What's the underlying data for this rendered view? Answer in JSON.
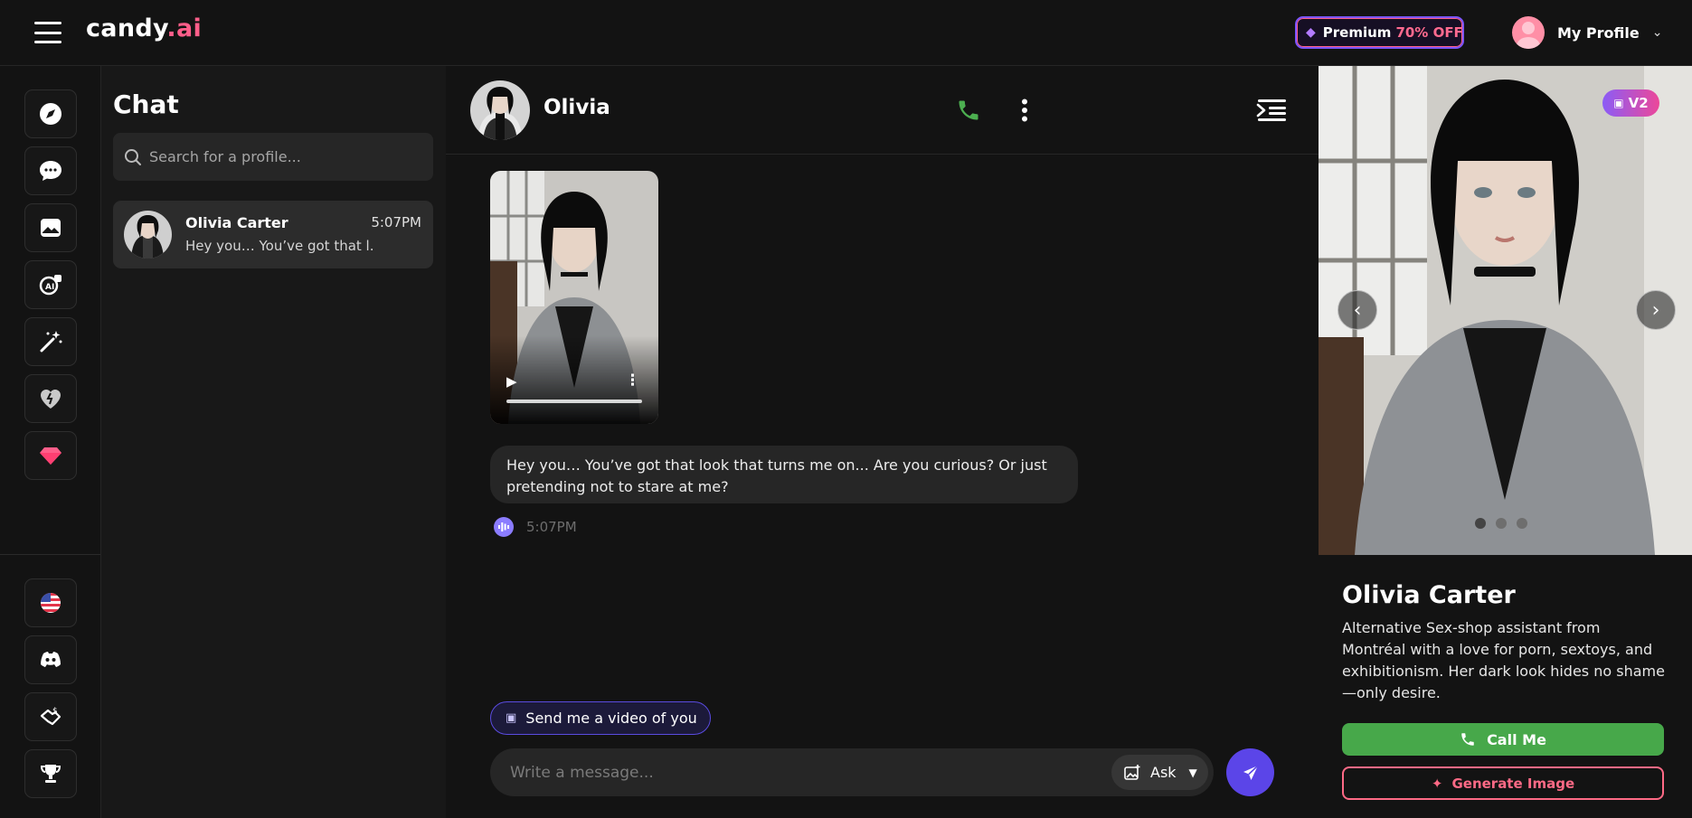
{
  "app": {
    "logo_main": "candy",
    "logo_accent": ".ai"
  },
  "header": {
    "premium_label": "Premium",
    "premium_discount": "70% OFF",
    "profile_label": "My Profile"
  },
  "sidebar": {
    "top_icons": [
      "compass-icon",
      "chat-bubble-icon",
      "image-gallery-icon",
      "ai-avatar-icon",
      "magic-wand-icon",
      "heart-icon",
      "diamond-icon"
    ],
    "bottom_icons": [
      "us-flag-icon",
      "discord-icon",
      "affiliate-icon",
      "trophy-icon"
    ]
  },
  "chat_list": {
    "title": "Chat",
    "search_placeholder": "Search for a profile...",
    "conversations": [
      {
        "name": "Olivia Carter",
        "time": "5:07PM",
        "preview": "Hey you… You’ve got that l..."
      }
    ]
  },
  "conversation": {
    "title": "Olivia",
    "messages": [
      {
        "type": "video"
      },
      {
        "type": "text",
        "text": "Hey you… You’ve got that look that turns me on... Are you curious? Or just pretending not to stare at me?",
        "time": "5:07PM"
      }
    ],
    "suggestion_chip": "Send me a video of you",
    "composer_placeholder": "Write a message...",
    "ask_label": "Ask"
  },
  "profile_panel": {
    "version_badge": "V2",
    "name": "Olivia Carter",
    "description": "Alternative Sex-shop assistant from Montréal with a love for porn, sextoys, and exhibitionism. Her dark look hides no shame—only desire.",
    "call_button": "Call Me",
    "generate_button": "Generate Image",
    "carousel_count": 3
  },
  "colors": {
    "accent_pink": "#ff5e8a",
    "brand_purple": "#5b45e8",
    "call_green": "#47a84a"
  }
}
